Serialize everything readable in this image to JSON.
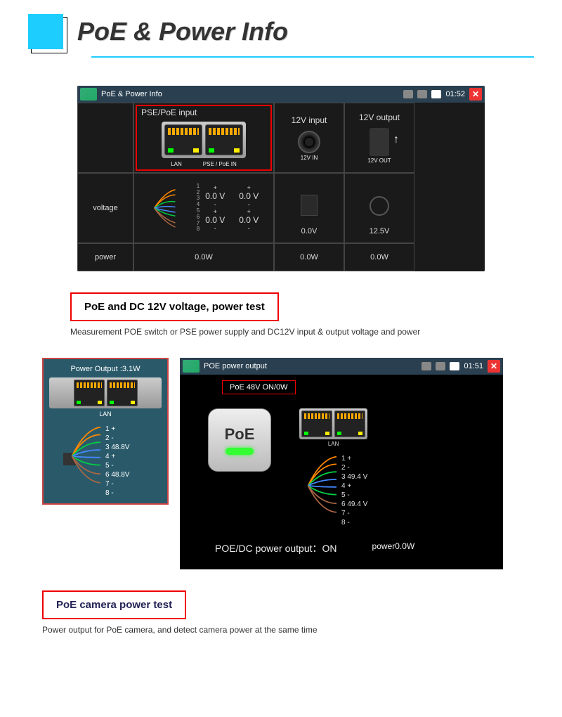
{
  "title": "PoE & Power Info",
  "screen1": {
    "statusbar_title": "PoE & Power Info",
    "time": "01:52",
    "headers": {
      "pse": "PSE/PoE input",
      "in12v": "12V input",
      "out12v": "12V output"
    },
    "port_labels": {
      "lan": "LAN",
      "pse": "PSE / PoE IN",
      "in12v": "12V IN",
      "out12v": "12V OUT"
    },
    "rows": {
      "voltage": "voltage",
      "power": "power"
    },
    "pse_values": {
      "pair1": "0.0 V",
      "pair2": "0.0 V",
      "pair3": "0.0 V",
      "pair4": "0.0 V"
    },
    "in12v_voltage": "0.0V",
    "out12v_voltage": "12.5V",
    "pse_power": "0.0W",
    "in12v_power": "0.0W",
    "out12v_power": "0.0W"
  },
  "caption1": {
    "heading": "PoE and DC 12V voltage, power test",
    "desc": "Measurement POE switch or PSE power supply and DC12V input & output voltage and power"
  },
  "panel_left": {
    "power_output": "Power Output :3.1W",
    "lan_label": "LAN",
    "pins": {
      "p1": "1 +",
      "p2": "2 -",
      "p3": "3 48.8V",
      "p4": "4 +",
      "p5": "5 -",
      "p6": "6 48.8V",
      "p7": "7 -",
      "p8": "8 -"
    }
  },
  "screen2": {
    "statusbar_title": "POE power output",
    "time": "01:51",
    "status": "PoE 48V ON/0W",
    "btn_label": "PoE",
    "lan_label": "LAN",
    "pins": {
      "p1": "1 +",
      "p2": "2 -",
      "p3": "3 49.4 V",
      "p4": "4 +",
      "p5": "5 -",
      "p6": "6 49.4 V",
      "p7": "7 -",
      "p8": "8 -"
    },
    "footer_status": "POE/DC power output：ON",
    "footer_power": "power0.0W"
  },
  "caption2": {
    "heading": "PoE camera power test",
    "desc": "Power output for PoE camera, and detect camera power at the same time"
  }
}
